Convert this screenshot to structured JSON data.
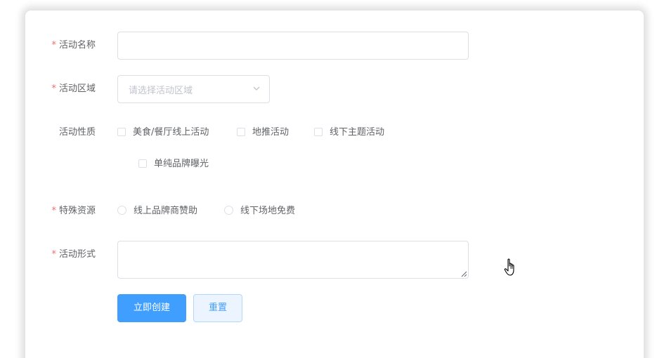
{
  "form": {
    "name": {
      "label": "活动名称",
      "required_mark": "*",
      "value": ""
    },
    "region": {
      "label": "活动区域",
      "required_mark": "*",
      "placeholder": "请选择活动区域"
    },
    "type": {
      "label": "活动性质",
      "options": [
        {
          "label": "美食/餐厅线上活动",
          "checked": false
        },
        {
          "label": "地推活动",
          "checked": false
        },
        {
          "label": "线下主题活动",
          "checked": false
        },
        {
          "label": "单纯品牌曝光",
          "checked": false
        }
      ]
    },
    "resource": {
      "label": "特殊资源",
      "required_mark": "*",
      "options": [
        {
          "label": "线上品牌商赞助",
          "selected": false
        },
        {
          "label": "线下场地免费",
          "selected": false
        }
      ]
    },
    "desc": {
      "label": "活动形式",
      "required_mark": "*",
      "value": ""
    },
    "buttons": {
      "submit": "立即创建",
      "reset": "重置"
    }
  },
  "icons": {
    "select_arrow": "chevron-down-icon",
    "cursor": "hand-pointer-icon"
  },
  "colors": {
    "primary": "#409eff",
    "required": "#f56c6c",
    "border": "#dcdfe6",
    "label": "#606266",
    "placeholder": "#c0c4cc"
  }
}
